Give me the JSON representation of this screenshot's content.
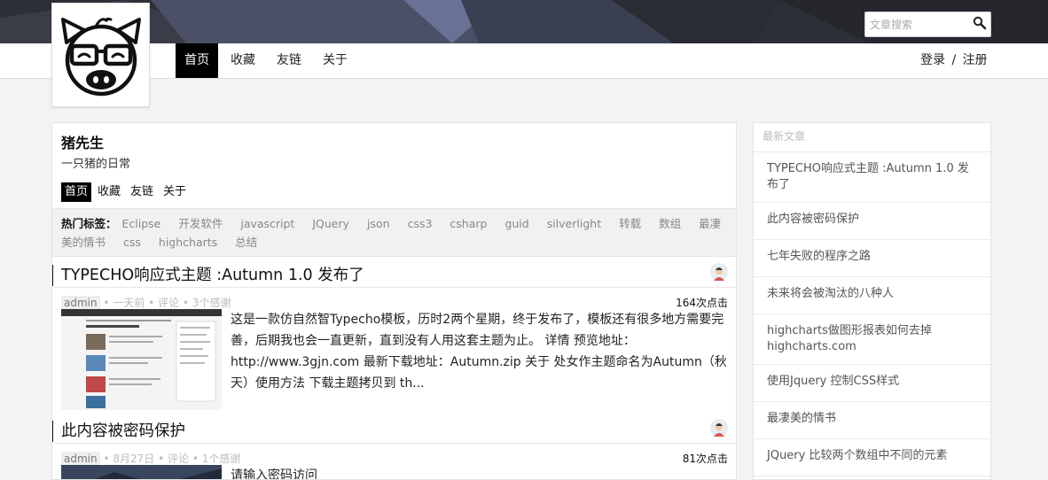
{
  "header": {
    "search_placeholder": "文章搜索",
    "search_icon": "search-icon",
    "nav": [
      {
        "label": "首页",
        "active": true
      },
      {
        "label": "收藏",
        "active": false
      },
      {
        "label": "友链",
        "active": false
      },
      {
        "label": "关于",
        "active": false
      }
    ],
    "login_label": "登录",
    "separator": "/",
    "register_label": "注册"
  },
  "logo": {
    "icon": "pig-logo-icon"
  },
  "site": {
    "title": "猪先生",
    "description": "一只猪的日常",
    "subnav": [
      {
        "label": "首页",
        "active": true
      },
      {
        "label": "收藏",
        "active": false
      },
      {
        "label": "友链",
        "active": false
      },
      {
        "label": "关于",
        "active": false
      }
    ]
  },
  "tags": {
    "label": "热门标签：",
    "items": [
      "Eclipse",
      "开发软件",
      "javascript",
      "JQuery",
      "json",
      "css3",
      "csharp",
      "guid",
      "silverlight",
      "转载",
      "数组",
      "最凄美的情书",
      "css",
      "highcharts",
      "总结"
    ]
  },
  "posts": [
    {
      "title": "TYPECHO响应式主题 :Autumn 1.0 发布了",
      "author": "admin",
      "date": "一天前",
      "comments": "评论",
      "thanks": "3个感谢",
      "dot": "•",
      "views": "164次点击",
      "excerpt": "这是一款仿自然智Typecho模板，历时2两个星期，终于发布了，模板还有很多地方需要完善，后期我也会一直更新，直到没有人用这套主题为止。 详情 预览地址：http://www.3gjn.com 最新下载地址：Autumn.zip 关于 处女作主题命名为Autumn（秋天）使用方法 下载主题拷贝到 th..."
    },
    {
      "title": "此内容被密码保护",
      "author": "admin",
      "date": "8月27日",
      "comments": "评论",
      "thanks": "1个感谢",
      "dot": "•",
      "views": "81次点击",
      "excerpt": "请输入密码访问"
    }
  ],
  "sidebar": {
    "title": "最新文章",
    "items": [
      "TYPECHO响应式主题 :Autumn 1.0 发布了",
      "此内容被密码保护",
      "七年失败的程序之路",
      "未来将会被淘汰的八种人",
      "highcharts做图形报表如何去掉highcharts.com",
      "使用Jquery 控制CSS样式",
      "最凄美的情书",
      "JQuery 比较两个数组中不同的元素"
    ]
  },
  "colors": {
    "banner": "#2d2f36",
    "active_nav": "#000000",
    "accent_bar": "#111111"
  }
}
